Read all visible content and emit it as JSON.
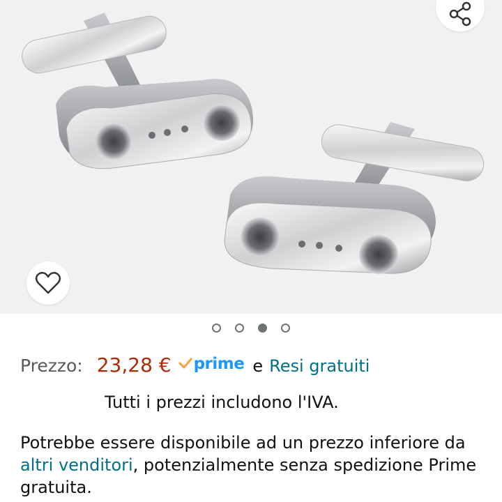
{
  "gallery": {
    "image_alt": "Gemelli a forma di maglia di catena per bicicletta",
    "dots_count": 4,
    "active_dot": 3
  },
  "price": {
    "label": "Prezzo:",
    "value": "23,28 €",
    "prime_label": "prime",
    "and_text": "e",
    "returns_link": "Resi gratuiti"
  },
  "vat_note": "Tutti i prezzi includono l'IVA.",
  "other_sellers": {
    "text_before": "Potrebbe essere disponibile ad un prezzo inferiore da ",
    "link": "altri venditori",
    "text_after": ", potenzialmente senza spedizione Prime gratuita."
  },
  "icons": {
    "share": "share-icon",
    "wishlist": "heart-icon",
    "prime_check": "checkmark-icon"
  },
  "colors": {
    "price": "#b12704",
    "link": "#007185",
    "prime": "#1a98ff",
    "check": "#f3a847"
  }
}
